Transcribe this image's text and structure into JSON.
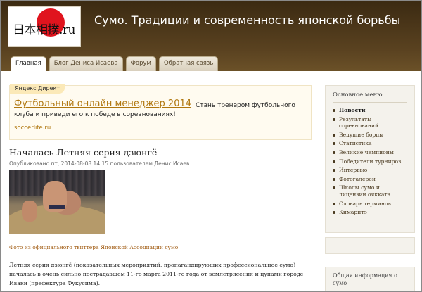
{
  "header": {
    "logo_text": "日本相撲.ru",
    "site_title": "Сумо. Традиции и современность японской борьбы",
    "tabs": [
      {
        "label": "Главная",
        "active": true
      },
      {
        "label": "Блог Дениса Исаева",
        "active": false
      },
      {
        "label": "Форум",
        "active": false
      },
      {
        "label": "Обратная связь",
        "active": false
      }
    ]
  },
  "ad": {
    "label": "Яндекс Директ",
    "title": "Футбольный онлайн менеджер 2014",
    "text": "Стань тренером футбольного клуба и приведи его к победе в соревнованиях!",
    "url": "soccerlife.ru"
  },
  "post": {
    "title": "Началась Летняя серия дзюнгё",
    "meta": "Опубликовано пт, 2014-08-08 14:15 пользователем Денис Исаев",
    "caption": "Фото из официального твиттера Японской Ассоциации сумо",
    "body": "Летняя серия дзюнгё (показательных мероприятий, пропагандирующих профессиональное сумо) началась в очень сильно пострадавшем 11-го марта 2011-го года от землетрясения и цунами городе Иваки (префектура Фукусима)."
  },
  "sidebar": {
    "menu_title": "Основное меню",
    "menu_items": [
      "Новости",
      "Результаты соревнований",
      "Ведущие борцы",
      "Статистика",
      "Великие чемпионы",
      "Победители турниров",
      "Интервью",
      "Фотогалереи",
      "Школы сумо и лицензии оякката",
      "Словарь терминов",
      "Кимаритэ"
    ],
    "info_title": "Общая информация о сумо"
  },
  "colors": {
    "header_bg": "#4a361a",
    "link": "#b0770f",
    "caption": "#a05a10",
    "sun": "#e0141e"
  }
}
